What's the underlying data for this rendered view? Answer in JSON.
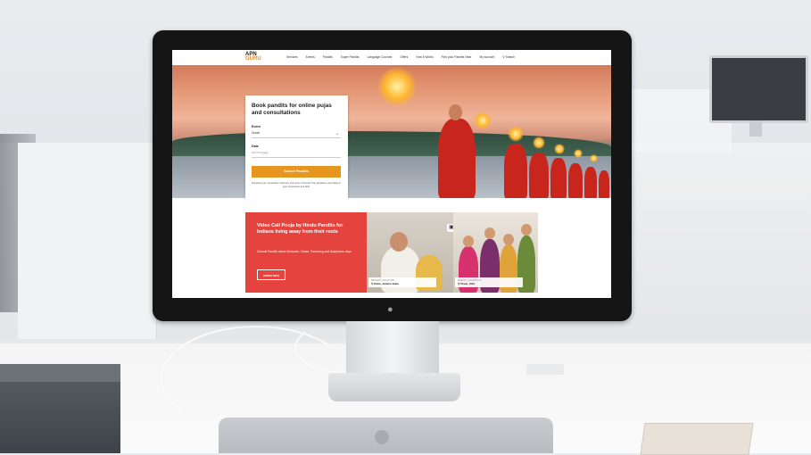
{
  "nav": {
    "logo_line1": "APN",
    "logo_line2": "GURU",
    "items": [
      "Services",
      "Events",
      "Pandits",
      "Super Pandits",
      "Language Courses",
      "Offers",
      "How it Works",
      "Find your Pandits Near",
      "My account",
      "Search"
    ]
  },
  "booking": {
    "title": "Book pandits for online pujas and consultations",
    "event_label": "Event",
    "event_value": "Diwali",
    "date_label": "Date",
    "date_placeholder": "dd-mm-yyyy",
    "button": "Search Pandits",
    "note": "Donations are completely voluntary and never enforced. Pay donations according to your experience and faith"
  },
  "promo": {
    "title": "Video Call Pooja by Hindu Pandits for Indians living away from their roots",
    "subtitle": "Consult Pandits about Muhurats, Vratas, Panchang and Auspicious days",
    "button": "ORDER NOW",
    "pandit_location_label": "PANDIT LOCATION",
    "pandit_location": "Katra, Jammu India",
    "family_location_label": "FAMILY LOCATION",
    "family_location": "Texas, USA"
  },
  "colors": {
    "accent_orange": "#e6961e",
    "promo_red": "#e4433e",
    "robe_red": "#c8261c"
  },
  "icons": {
    "chevron": "chevron-down-icon",
    "search": "search-icon",
    "video": "video-camera-icon",
    "pin": "location-pin-icon",
    "apple": "apple-logo-icon"
  }
}
